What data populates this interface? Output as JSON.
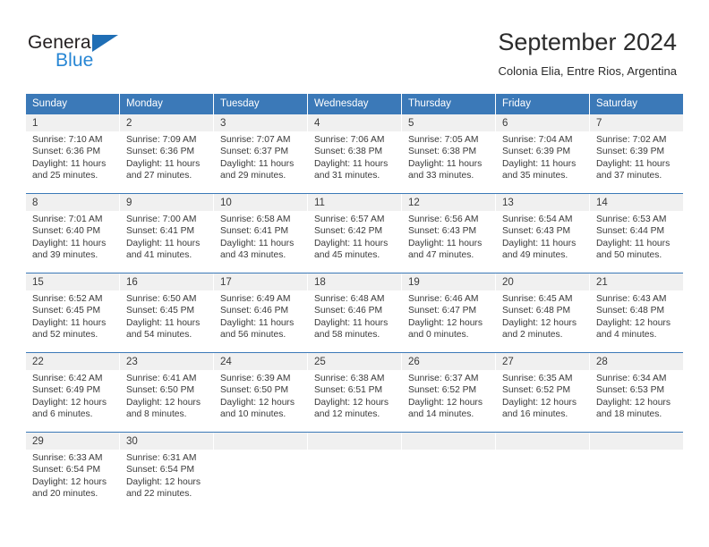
{
  "brand": {
    "name_part1": "General",
    "name_part2": "Blue",
    "triangle_icon": "triangle-icon",
    "accent_color": "#2786d4",
    "dark_color": "#231f20"
  },
  "header": {
    "title": "September 2024",
    "subtitle": "Colonia Elia, Entre Rios, Argentina"
  },
  "calendar": {
    "header_bg": "#3b79b8",
    "daynum_bg": "#f0f0f0",
    "weekdays": [
      "Sunday",
      "Monday",
      "Tuesday",
      "Wednesday",
      "Thursday",
      "Friday",
      "Saturday"
    ],
    "weeks": [
      [
        {
          "day": "1",
          "sunrise": "Sunrise: 7:10 AM",
          "sunset": "Sunset: 6:36 PM",
          "daylight1": "Daylight: 11 hours",
          "daylight2": "and 25 minutes."
        },
        {
          "day": "2",
          "sunrise": "Sunrise: 7:09 AM",
          "sunset": "Sunset: 6:36 PM",
          "daylight1": "Daylight: 11 hours",
          "daylight2": "and 27 minutes."
        },
        {
          "day": "3",
          "sunrise": "Sunrise: 7:07 AM",
          "sunset": "Sunset: 6:37 PM",
          "daylight1": "Daylight: 11 hours",
          "daylight2": "and 29 minutes."
        },
        {
          "day": "4",
          "sunrise": "Sunrise: 7:06 AM",
          "sunset": "Sunset: 6:38 PM",
          "daylight1": "Daylight: 11 hours",
          "daylight2": "and 31 minutes."
        },
        {
          "day": "5",
          "sunrise": "Sunrise: 7:05 AM",
          "sunset": "Sunset: 6:38 PM",
          "daylight1": "Daylight: 11 hours",
          "daylight2": "and 33 minutes."
        },
        {
          "day": "6",
          "sunrise": "Sunrise: 7:04 AM",
          "sunset": "Sunset: 6:39 PM",
          "daylight1": "Daylight: 11 hours",
          "daylight2": "and 35 minutes."
        },
        {
          "day": "7",
          "sunrise": "Sunrise: 7:02 AM",
          "sunset": "Sunset: 6:39 PM",
          "daylight1": "Daylight: 11 hours",
          "daylight2": "and 37 minutes."
        }
      ],
      [
        {
          "day": "8",
          "sunrise": "Sunrise: 7:01 AM",
          "sunset": "Sunset: 6:40 PM",
          "daylight1": "Daylight: 11 hours",
          "daylight2": "and 39 minutes."
        },
        {
          "day": "9",
          "sunrise": "Sunrise: 7:00 AM",
          "sunset": "Sunset: 6:41 PM",
          "daylight1": "Daylight: 11 hours",
          "daylight2": "and 41 minutes."
        },
        {
          "day": "10",
          "sunrise": "Sunrise: 6:58 AM",
          "sunset": "Sunset: 6:41 PM",
          "daylight1": "Daylight: 11 hours",
          "daylight2": "and 43 minutes."
        },
        {
          "day": "11",
          "sunrise": "Sunrise: 6:57 AM",
          "sunset": "Sunset: 6:42 PM",
          "daylight1": "Daylight: 11 hours",
          "daylight2": "and 45 minutes."
        },
        {
          "day": "12",
          "sunrise": "Sunrise: 6:56 AM",
          "sunset": "Sunset: 6:43 PM",
          "daylight1": "Daylight: 11 hours",
          "daylight2": "and 47 minutes."
        },
        {
          "day": "13",
          "sunrise": "Sunrise: 6:54 AM",
          "sunset": "Sunset: 6:43 PM",
          "daylight1": "Daylight: 11 hours",
          "daylight2": "and 49 minutes."
        },
        {
          "day": "14",
          "sunrise": "Sunrise: 6:53 AM",
          "sunset": "Sunset: 6:44 PM",
          "daylight1": "Daylight: 11 hours",
          "daylight2": "and 50 minutes."
        }
      ],
      [
        {
          "day": "15",
          "sunrise": "Sunrise: 6:52 AM",
          "sunset": "Sunset: 6:45 PM",
          "daylight1": "Daylight: 11 hours",
          "daylight2": "and 52 minutes."
        },
        {
          "day": "16",
          "sunrise": "Sunrise: 6:50 AM",
          "sunset": "Sunset: 6:45 PM",
          "daylight1": "Daylight: 11 hours",
          "daylight2": "and 54 minutes."
        },
        {
          "day": "17",
          "sunrise": "Sunrise: 6:49 AM",
          "sunset": "Sunset: 6:46 PM",
          "daylight1": "Daylight: 11 hours",
          "daylight2": "and 56 minutes."
        },
        {
          "day": "18",
          "sunrise": "Sunrise: 6:48 AM",
          "sunset": "Sunset: 6:46 PM",
          "daylight1": "Daylight: 11 hours",
          "daylight2": "and 58 minutes."
        },
        {
          "day": "19",
          "sunrise": "Sunrise: 6:46 AM",
          "sunset": "Sunset: 6:47 PM",
          "daylight1": "Daylight: 12 hours",
          "daylight2": "and 0 minutes."
        },
        {
          "day": "20",
          "sunrise": "Sunrise: 6:45 AM",
          "sunset": "Sunset: 6:48 PM",
          "daylight1": "Daylight: 12 hours",
          "daylight2": "and 2 minutes."
        },
        {
          "day": "21",
          "sunrise": "Sunrise: 6:43 AM",
          "sunset": "Sunset: 6:48 PM",
          "daylight1": "Daylight: 12 hours",
          "daylight2": "and 4 minutes."
        }
      ],
      [
        {
          "day": "22",
          "sunrise": "Sunrise: 6:42 AM",
          "sunset": "Sunset: 6:49 PM",
          "daylight1": "Daylight: 12 hours",
          "daylight2": "and 6 minutes."
        },
        {
          "day": "23",
          "sunrise": "Sunrise: 6:41 AM",
          "sunset": "Sunset: 6:50 PM",
          "daylight1": "Daylight: 12 hours",
          "daylight2": "and 8 minutes."
        },
        {
          "day": "24",
          "sunrise": "Sunrise: 6:39 AM",
          "sunset": "Sunset: 6:50 PM",
          "daylight1": "Daylight: 12 hours",
          "daylight2": "and 10 minutes."
        },
        {
          "day": "25",
          "sunrise": "Sunrise: 6:38 AM",
          "sunset": "Sunset: 6:51 PM",
          "daylight1": "Daylight: 12 hours",
          "daylight2": "and 12 minutes."
        },
        {
          "day": "26",
          "sunrise": "Sunrise: 6:37 AM",
          "sunset": "Sunset: 6:52 PM",
          "daylight1": "Daylight: 12 hours",
          "daylight2": "and 14 minutes."
        },
        {
          "day": "27",
          "sunrise": "Sunrise: 6:35 AM",
          "sunset": "Sunset: 6:52 PM",
          "daylight1": "Daylight: 12 hours",
          "daylight2": "and 16 minutes."
        },
        {
          "day": "28",
          "sunrise": "Sunrise: 6:34 AM",
          "sunset": "Sunset: 6:53 PM",
          "daylight1": "Daylight: 12 hours",
          "daylight2": "and 18 minutes."
        }
      ],
      [
        {
          "day": "29",
          "sunrise": "Sunrise: 6:33 AM",
          "sunset": "Sunset: 6:54 PM",
          "daylight1": "Daylight: 12 hours",
          "daylight2": "and 20 minutes."
        },
        {
          "day": "30",
          "sunrise": "Sunrise: 6:31 AM",
          "sunset": "Sunset: 6:54 PM",
          "daylight1": "Daylight: 12 hours",
          "daylight2": "and 22 minutes."
        },
        {
          "day": "",
          "sunrise": "",
          "sunset": "",
          "daylight1": "",
          "daylight2": ""
        },
        {
          "day": "",
          "sunrise": "",
          "sunset": "",
          "daylight1": "",
          "daylight2": ""
        },
        {
          "day": "",
          "sunrise": "",
          "sunset": "",
          "daylight1": "",
          "daylight2": ""
        },
        {
          "day": "",
          "sunrise": "",
          "sunset": "",
          "daylight1": "",
          "daylight2": ""
        },
        {
          "day": "",
          "sunrise": "",
          "sunset": "",
          "daylight1": "",
          "daylight2": ""
        }
      ]
    ]
  }
}
